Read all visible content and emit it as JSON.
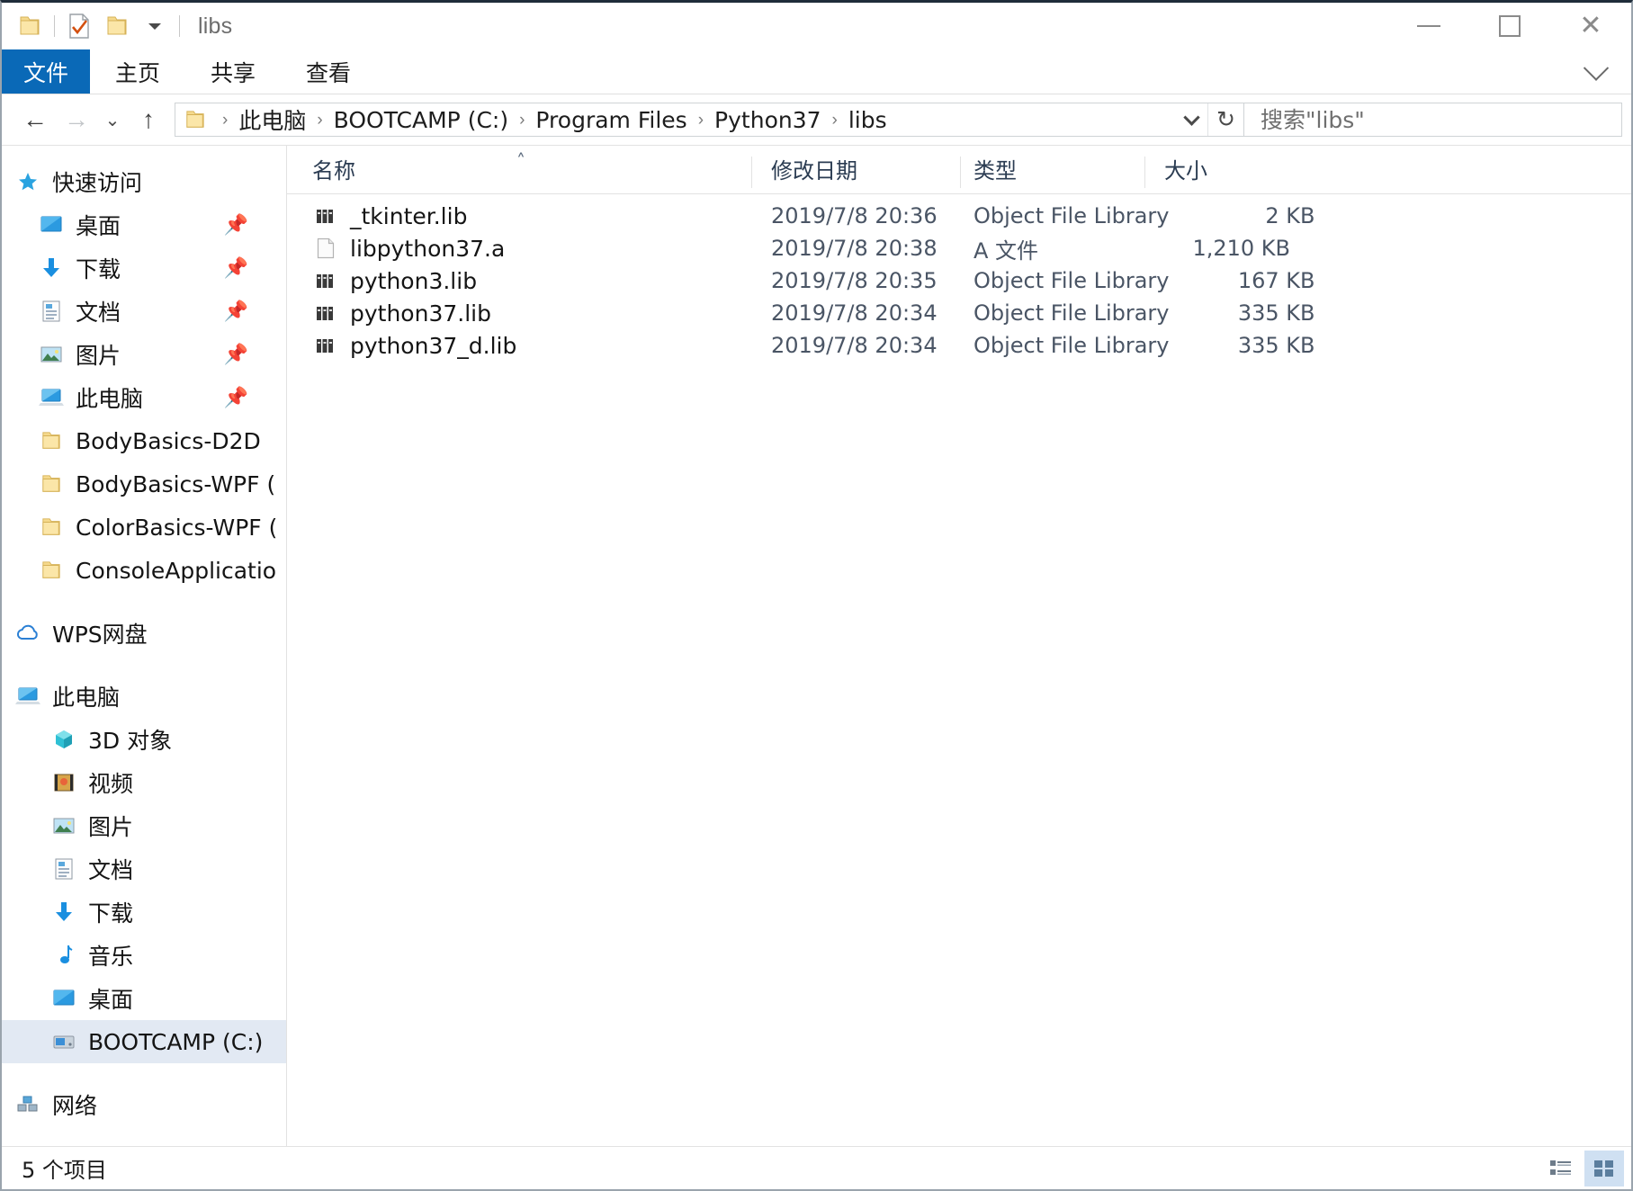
{
  "window": {
    "title": "libs",
    "controls": {
      "minimize": "—",
      "maximize": "□",
      "close": "✕"
    }
  },
  "quick_access_toolbar": {
    "items": [
      {
        "name": "folder-properties",
        "icon": "folder-icon"
      },
      {
        "name": "properties-checked",
        "icon": "document-check-icon"
      },
      {
        "name": "new-folder",
        "icon": "folder-icon"
      },
      {
        "name": "customize",
        "icon": "chevron-down-icon"
      }
    ]
  },
  "ribbon": {
    "tabs": [
      {
        "label": "文件",
        "active": true
      },
      {
        "label": "主页",
        "active": false
      },
      {
        "label": "共享",
        "active": false
      },
      {
        "label": "查看",
        "active": false
      }
    ],
    "expand_icon": "chevron-down-icon",
    "accent": "#0a69b7"
  },
  "navigation": {
    "back": "←",
    "forward": "→",
    "recent": "⌄",
    "up": "↑",
    "refresh": "↻",
    "dropdown": "chevron-down-icon"
  },
  "breadcrumb": {
    "separator": "›",
    "items": [
      "此电脑",
      "BOOTCAMP (C:)",
      "Program Files",
      "Python37",
      "libs"
    ]
  },
  "search": {
    "placeholder": "搜索\"libs\"",
    "value": ""
  },
  "sidebar": {
    "sections": [
      {
        "header": {
          "label": "快速访问",
          "icon": "star-icon"
        },
        "items": [
          {
            "label": "桌面",
            "icon": "desktop-icon",
            "pinned": true
          },
          {
            "label": "下载",
            "icon": "download-icon",
            "pinned": true
          },
          {
            "label": "文档",
            "icon": "documents-icon",
            "pinned": true
          },
          {
            "label": "图片",
            "icon": "pictures-icon",
            "pinned": true
          },
          {
            "label": "此电脑",
            "icon": "this-pc-icon",
            "pinned": true
          },
          {
            "label": "BodyBasics-D2D",
            "icon": "folder-icon",
            "pinned": false
          },
          {
            "label": "BodyBasics-WPF  (",
            "icon": "folder-icon",
            "pinned": false
          },
          {
            "label": "ColorBasics-WPF  (",
            "icon": "folder-icon",
            "pinned": false
          },
          {
            "label": "ConsoleApplicatio",
            "icon": "folder-icon",
            "pinned": false
          }
        ]
      },
      {
        "header": {
          "label": "WPS网盘",
          "icon": "cloud-icon"
        },
        "items": []
      },
      {
        "header": {
          "label": "此电脑",
          "icon": "this-pc-icon"
        },
        "items": [
          {
            "label": "3D 对象",
            "icon": "3d-objects-icon",
            "selected": false
          },
          {
            "label": "视频",
            "icon": "videos-icon",
            "selected": false
          },
          {
            "label": "图片",
            "icon": "pictures-icon",
            "selected": false
          },
          {
            "label": "文档",
            "icon": "documents-icon",
            "selected": false
          },
          {
            "label": "下载",
            "icon": "download-icon",
            "selected": false
          },
          {
            "label": "音乐",
            "icon": "music-icon",
            "selected": false
          },
          {
            "label": "桌面",
            "icon": "desktop-icon",
            "selected": false
          },
          {
            "label": "BOOTCAMP (C:)",
            "icon": "drive-icon",
            "selected": true
          }
        ]
      },
      {
        "header": {
          "label": "网络",
          "icon": "network-icon"
        },
        "items": []
      }
    ],
    "selection_color": "#e2e9f3"
  },
  "file_list": {
    "columns": [
      {
        "label": "名称",
        "sorted": "asc",
        "sort_glyph": "˄"
      },
      {
        "label": "修改日期",
        "sorted": ""
      },
      {
        "label": "类型",
        "sorted": ""
      },
      {
        "label": "大小",
        "sorted": ""
      }
    ],
    "rows": [
      {
        "name": "_tkinter.lib",
        "icon": "object-library-icon",
        "date": "2019/7/8 20:36",
        "type": "Object File Library",
        "size": "2 KB"
      },
      {
        "name": "libpython37.a",
        "icon": "generic-file-icon",
        "date": "2019/7/8 20:38",
        "type": "A 文件",
        "size": "1,210 KB"
      },
      {
        "name": "python3.lib",
        "icon": "object-library-icon",
        "date": "2019/7/8 20:35",
        "type": "Object File Library",
        "size": "167 KB"
      },
      {
        "name": "python37.lib",
        "icon": "object-library-icon",
        "date": "2019/7/8 20:34",
        "type": "Object File Library",
        "size": "335 KB"
      },
      {
        "name": "python37_d.lib",
        "icon": "object-library-icon",
        "date": "2019/7/8 20:34",
        "type": "Object File Library",
        "size": "335 KB"
      }
    ]
  },
  "status_bar": {
    "item_count_text": "5 个项目",
    "views": [
      {
        "name": "details-view",
        "active": false
      },
      {
        "name": "large-icons-view",
        "active": true
      }
    ]
  }
}
